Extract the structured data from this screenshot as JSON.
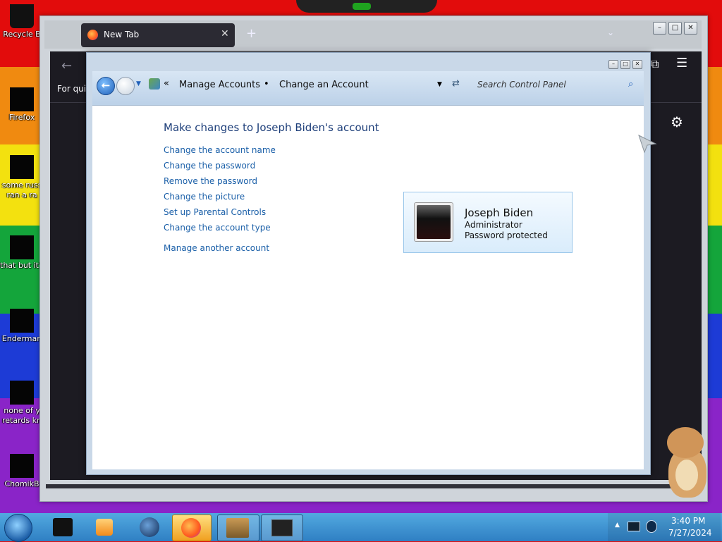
{
  "desktop": {
    "icons": [
      {
        "label": "Recycle B"
      },
      {
        "label": "Firefox"
      },
      {
        "label": "some russ\nran a ra"
      },
      {
        "label": "that but it's"
      },
      {
        "label": "Enderman"
      },
      {
        "label": "none of y\nretards kn"
      },
      {
        "label": "ChomikB"
      }
    ]
  },
  "firefox": {
    "tab_title": "New Tab",
    "new_tab_glyph": "+",
    "quick_text": "For quic"
  },
  "control_panel": {
    "breadcrumb": {
      "prefix": "«",
      "item1": "Manage Accounts",
      "separator": "•",
      "item2": "Change an Account"
    },
    "search_placeholder": "Search Control Panel",
    "heading": "Make changes to Joseph Biden's account",
    "links": [
      "Change the account name",
      "Change the password",
      "Remove the password",
      "Change the picture",
      "Set up Parental Controls",
      "Change the account type"
    ],
    "manage_another": "Manage another account",
    "account": {
      "name": "Joseph Biden",
      "role": "Administrator",
      "status": "Password protected"
    }
  },
  "taskbar": {
    "time": "3:40 PM",
    "date": "7/27/2024"
  },
  "colors": {
    "link": "#1a5fa8",
    "firefox_dark": "#1c1b22",
    "taskbar": "#3a8cd0"
  }
}
